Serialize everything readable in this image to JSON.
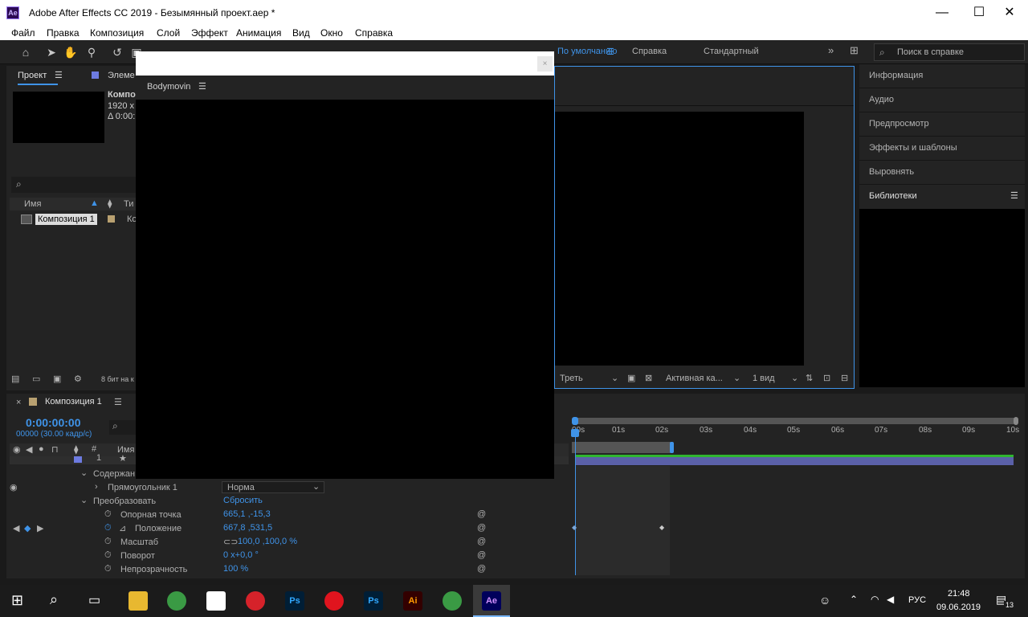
{
  "window": {
    "title": "Adobe After Effects CC 2019 - Безымянный проект.aep *",
    "app_icon": "Ae",
    "minimize": "—",
    "maximize": "☐",
    "close": "✕"
  },
  "menu": [
    "Файл",
    "Правка",
    "Композиция",
    "Слой",
    "Эффект",
    "Анимация",
    "Вид",
    "Окно",
    "Справка"
  ],
  "toolbar": {
    "workspaces": [
      "По умолчанию",
      "Справка",
      "Стандартный"
    ],
    "help_search_placeholder": "Поиск в справке"
  },
  "project_panel": {
    "tab_label": "Проект",
    "second_tab_label": "Элеме",
    "comp_name": "Компо",
    "comp_size": "1920 x",
    "comp_duration": "Δ 0:00:",
    "col_name": "Имя",
    "col_type": "Ти",
    "item_name": "Композиция 1",
    "item_type": "Ко",
    "bit_depth": "8 бит на к"
  },
  "bodymovin": {
    "title": "Bodymovin",
    "close_label": "×"
  },
  "composition_viewer": {
    "view_option": "Треть",
    "camera": "Активная ка...",
    "views": "1 вид"
  },
  "right_panel": {
    "items": [
      "Информация",
      "Аудио",
      "Предпросмотр",
      "Эффекты и шаблоны",
      "Выровнять",
      "Библиотеки"
    ]
  },
  "timeline": {
    "tab_label": "Композиция 1",
    "timecode": "0:00:00:00",
    "frame_info": "00000 (30.00 кадр/с)",
    "col_name": "Имя",
    "layer_number": "1",
    "contents_label": "Содержан",
    "rectangle_label": "Прямоугольник 1",
    "blend_mode": "Норма",
    "transform_label": "Преобразовать",
    "reset_label": "Сбросить",
    "properties": [
      {
        "name": "Опорная точка",
        "value": "665,1 ,-15,3"
      },
      {
        "name": "Положение",
        "value": "667,8 ,531,5"
      },
      {
        "name": "Масштаб",
        "value": "100,0 ,100,0 %"
      },
      {
        "name": "Поворот",
        "value": "0 x+0,0 °"
      },
      {
        "name": "Непрозрачность",
        "value": "100 %"
      }
    ],
    "ruler": [
      "00s",
      "01s",
      "02s",
      "03s",
      "04s",
      "05s",
      "06s",
      "07s",
      "08s",
      "09s",
      "10s"
    ]
  },
  "taskbar": {
    "language": "РУС",
    "time": "21:48",
    "date": "09.06.2019",
    "notifications": "13",
    "apps": [
      "Ps",
      "Ps",
      "Ai",
      "Ae"
    ]
  }
}
